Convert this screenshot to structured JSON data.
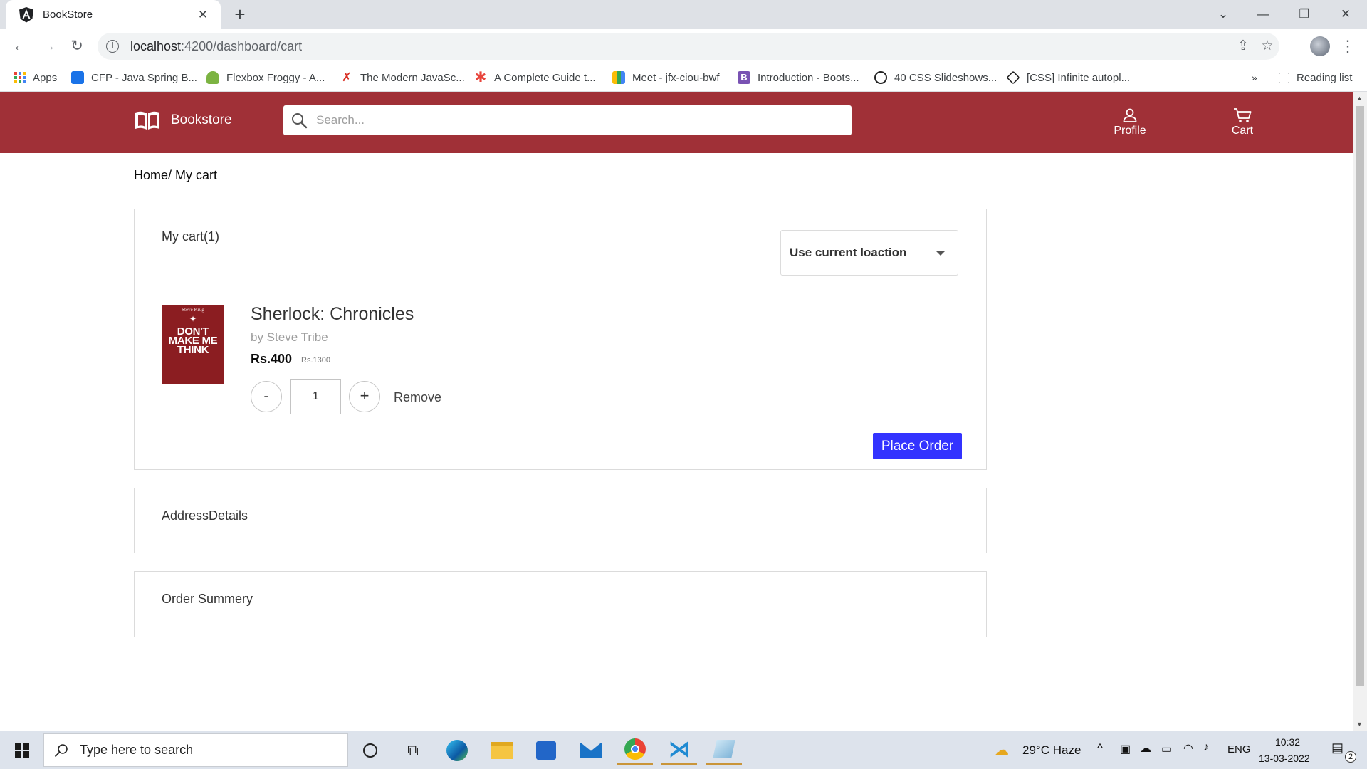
{
  "browser": {
    "tab_title": "BookStore",
    "url_host": "localhost",
    "url_path": ":4200/dashboard/cart",
    "bookmarks": [
      "Apps",
      "CFP - Java Spring B...",
      "Flexbox Froggy - A...",
      "The Modern JavaSc...",
      "A Complete Guide t...",
      "Meet - jfx-ciou-bwf",
      "Introduction · Boots...",
      "40 CSS Slideshows...",
      "[CSS] Infinite autopl..."
    ],
    "overflow": "»",
    "reading_list": "Reading list"
  },
  "header": {
    "brand": "Bookstore",
    "search_placeholder": "Search...",
    "profile_label": "Profile",
    "cart_label": "Cart",
    "bar_color": "#a03037"
  },
  "breadcrumb": "Home/ My cart",
  "cart": {
    "title": "My cart(1)",
    "location_select": "Use current loaction",
    "item": {
      "cover_author": "Steve Krug",
      "cover_text": "DON'T MAKE ME THINK",
      "title": "Sherlock: Chronicles",
      "author": "by Steve Tribe",
      "price": "Rs.400",
      "old_price": "Rs.1300",
      "quantity": "1",
      "decrement": "-",
      "increment": "+",
      "remove": "Remove"
    },
    "place_order": "Place Order",
    "button_color": "#3333ff"
  },
  "sections": {
    "address": "AddressDetails",
    "summary": "Order Summery"
  },
  "taskbar": {
    "search_placeholder": "Type here to search",
    "weather": "29°C  Haze",
    "language": "ENG",
    "time": "10:32",
    "date": "13-03-2022",
    "notifications": "2"
  }
}
